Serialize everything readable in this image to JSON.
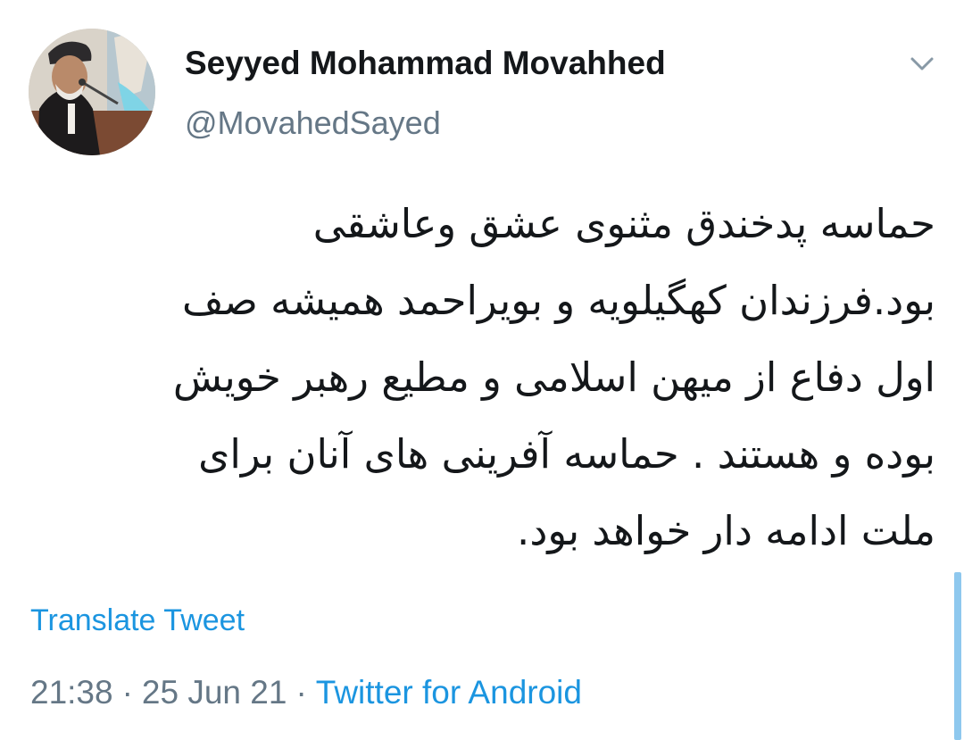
{
  "colors": {
    "text": "#14171a",
    "secondary": "#657786",
    "link": "#1b95e0",
    "scrollbar": "#8ec8ee"
  },
  "author": {
    "name": "Seyyed Mohammad Movahhed",
    "handle": "@MovahedSayed",
    "avatar_icon": "profile-photo"
  },
  "menu": {
    "icon": "chevron-down-icon"
  },
  "tweet": {
    "text": "حماسه پدخندق مثنوی عشق وعاشقی\nبود.فرزندان کهگیلویه و بویراحمد  همیشه صف\nاول دفاع از میهن اسلامی و مطیع رهبر خویش\nبوده و هستند . حماسه آفرینی های آنان برای\nملت ادامه دار خواهد بود."
  },
  "translate_label": "Translate Tweet",
  "meta": {
    "time": "21:38",
    "separator": "·",
    "date": "25 Jun 21",
    "source": "Twitter for Android"
  }
}
